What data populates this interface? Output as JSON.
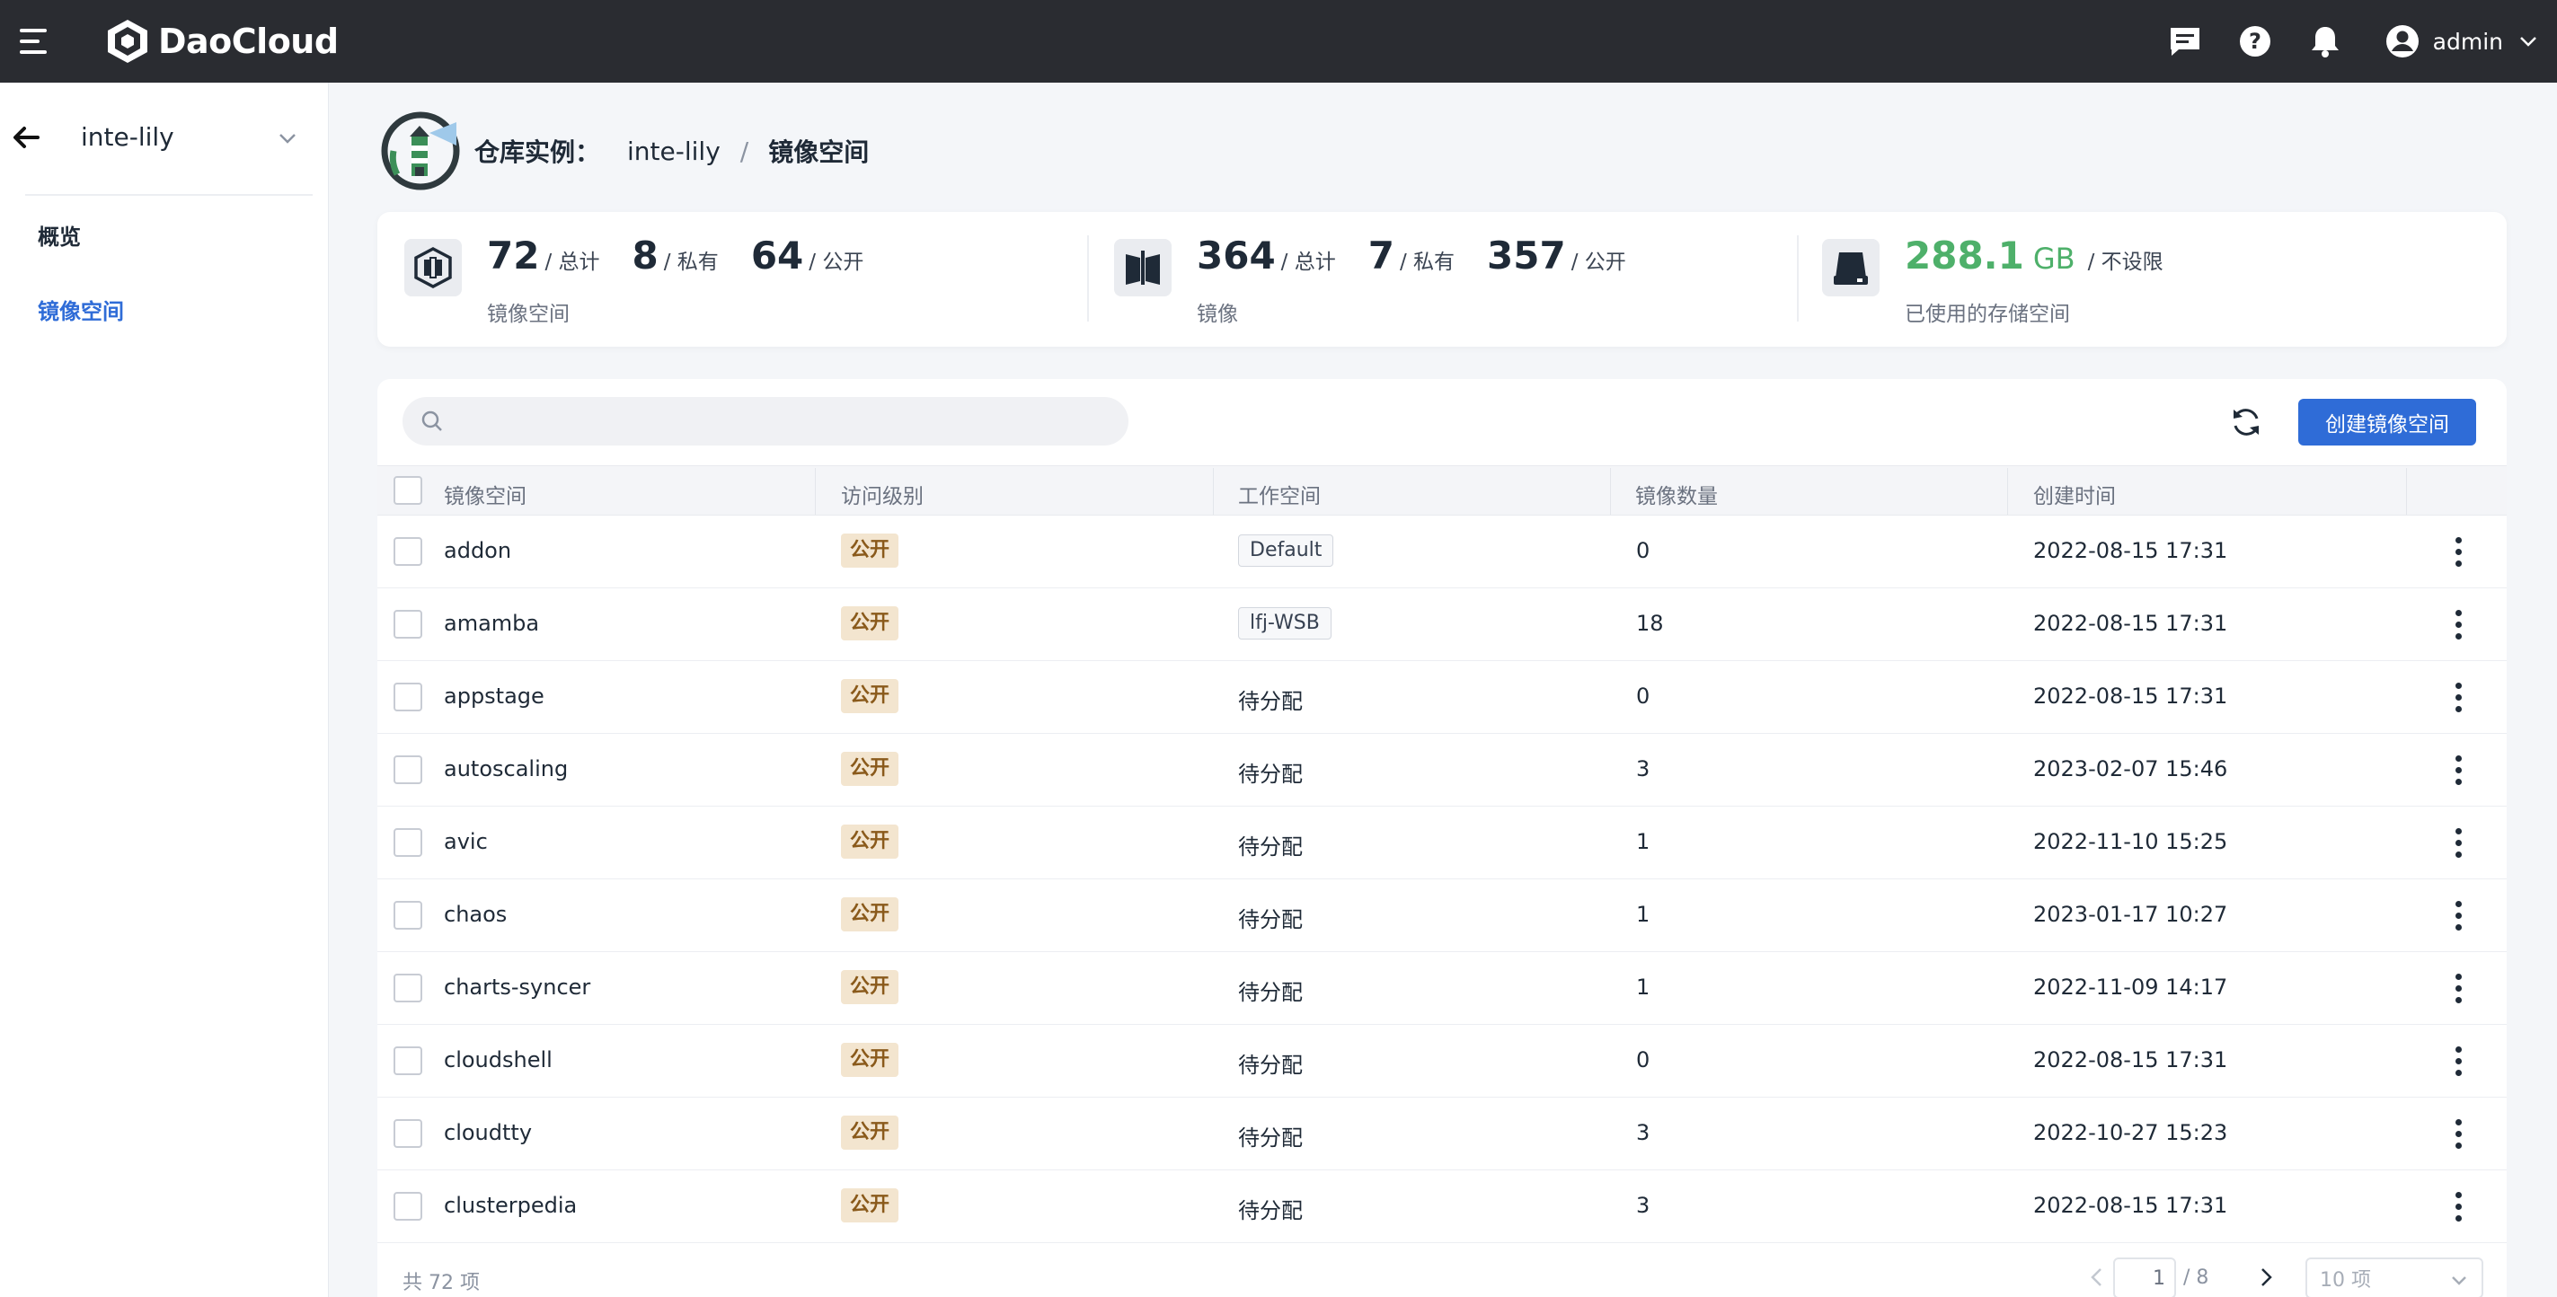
{
  "topbar": {
    "brand": "DaoCloud",
    "user": "admin"
  },
  "sidebar": {
    "title": "inte-lily",
    "items": [
      {
        "label": "概览"
      },
      {
        "label": "镜像空间"
      }
    ]
  },
  "breadcrumb": {
    "label": "仓库实例：",
    "instance": "inte-lily",
    "separator": "/",
    "current": "镜像空间"
  },
  "stats": {
    "spaces": {
      "total": "72",
      "total_unit": "/ 总计",
      "private": "8",
      "private_unit": "/ 私有",
      "public": "64",
      "public_unit": "/ 公开",
      "label": "镜像空间"
    },
    "images": {
      "total": "364",
      "total_unit": "/ 总计",
      "private": "7",
      "private_unit": "/ 私有",
      "public": "357",
      "public_unit": "/ 公开",
      "label": "镜像"
    },
    "storage": {
      "used": "288.1",
      "unit": "GB",
      "limit": "/ 不设限",
      "label": "已使用的存储空间"
    }
  },
  "toolbar": {
    "search_placeholder": "",
    "create_label": "创建镜像空间"
  },
  "table": {
    "headers": [
      "镜像空间",
      "访问级别",
      "工作空间",
      "镜像数量",
      "创建时间"
    ],
    "rows": [
      {
        "name": "addon",
        "access": "公开",
        "workspace": "Default",
        "workspace_tag": true,
        "count": "0",
        "created": "2022-08-15 17:31"
      },
      {
        "name": "amamba",
        "access": "公开",
        "workspace": "lfj-WSB",
        "workspace_tag": true,
        "count": "18",
        "created": "2022-08-15 17:31"
      },
      {
        "name": "appstage",
        "access": "公开",
        "workspace": "待分配",
        "workspace_tag": false,
        "count": "0",
        "created": "2022-08-15 17:31"
      },
      {
        "name": "autoscaling",
        "access": "公开",
        "workspace": "待分配",
        "workspace_tag": false,
        "count": "3",
        "created": "2023-02-07 15:46"
      },
      {
        "name": "avic",
        "access": "公开",
        "workspace": "待分配",
        "workspace_tag": false,
        "count": "1",
        "created": "2022-11-10 15:25"
      },
      {
        "name": "chaos",
        "access": "公开",
        "workspace": "待分配",
        "workspace_tag": false,
        "count": "1",
        "created": "2023-01-17 10:27"
      },
      {
        "name": "charts-syncer",
        "access": "公开",
        "workspace": "待分配",
        "workspace_tag": false,
        "count": "1",
        "created": "2022-11-09 14:17"
      },
      {
        "name": "cloudshell",
        "access": "公开",
        "workspace": "待分配",
        "workspace_tag": false,
        "count": "0",
        "created": "2022-08-15 17:31"
      },
      {
        "name": "cloudtty",
        "access": "公开",
        "workspace": "待分配",
        "workspace_tag": false,
        "count": "3",
        "created": "2022-10-27 15:23"
      },
      {
        "name": "clusterpedia",
        "access": "公开",
        "workspace": "待分配",
        "workspace_tag": false,
        "count": "3",
        "created": "2022-08-15 17:31"
      }
    ]
  },
  "pagination": {
    "total": "共 72 项",
    "page": "1",
    "pages": "/ 8",
    "page_size": "10 项"
  },
  "colors": {
    "topbar": "#2a2c31",
    "primary": "#2f6cd7",
    "storage_green": "#4eb06a",
    "public_badge_bg": "#f3e5cf"
  }
}
